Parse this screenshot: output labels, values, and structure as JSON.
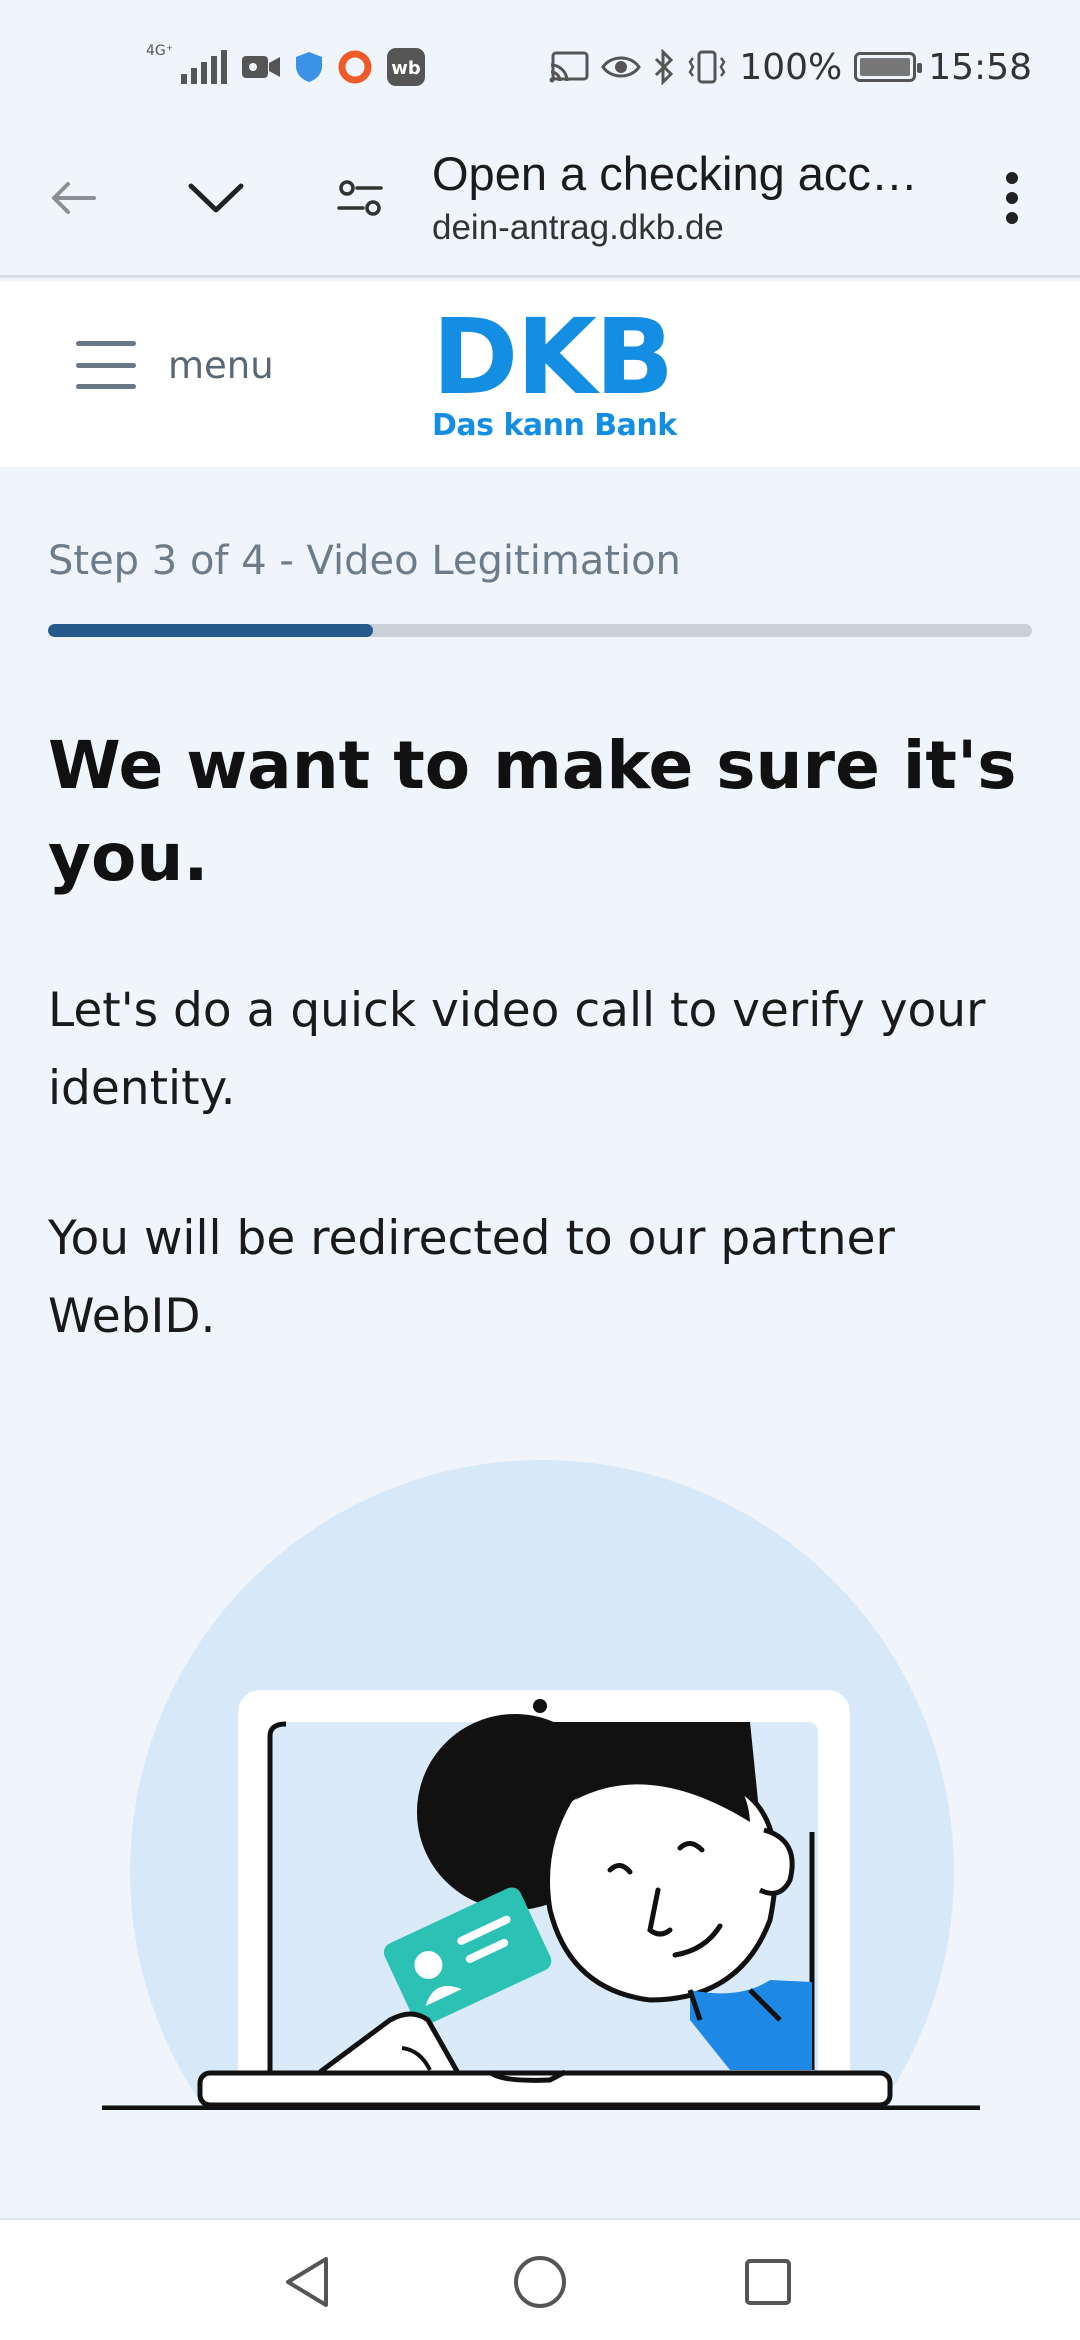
{
  "status_bar": {
    "network_label": "4G⁺",
    "battery": "100%",
    "battery_level": 1.0,
    "time": "15:58"
  },
  "browser": {
    "page_title": "Open a checking acc…",
    "url": "dein-antrag.dkb.de"
  },
  "site_header": {
    "menu_label": "menu",
    "logo_text": "DKB",
    "logo_tagline": "Das kann Bank"
  },
  "main": {
    "step_label": "Step 3 of 4 - Video Legitimation",
    "step_progress": 0.33,
    "headline": "We want to make sure it's you.",
    "paragraph_1": "Let's do a quick video call to verify your identity.",
    "paragraph_2": "You will be redirected to our partner WebID."
  },
  "colors": {
    "brand_blue": "#148ee3",
    "progress_fill": "#275a8c",
    "progress_track": "#c9d0d8",
    "page_bg": "#f0f5fc",
    "card_teal": "#2bc1b4"
  },
  "icons": {
    "back": "arrow-left-icon",
    "tabs": "chevron-down-icon",
    "site_settings": "tune-icon",
    "overflow": "more-vert-icon",
    "nav_back": "triangle-back-icon",
    "nav_home": "circle-home-icon",
    "nav_recents": "square-recents-icon"
  }
}
